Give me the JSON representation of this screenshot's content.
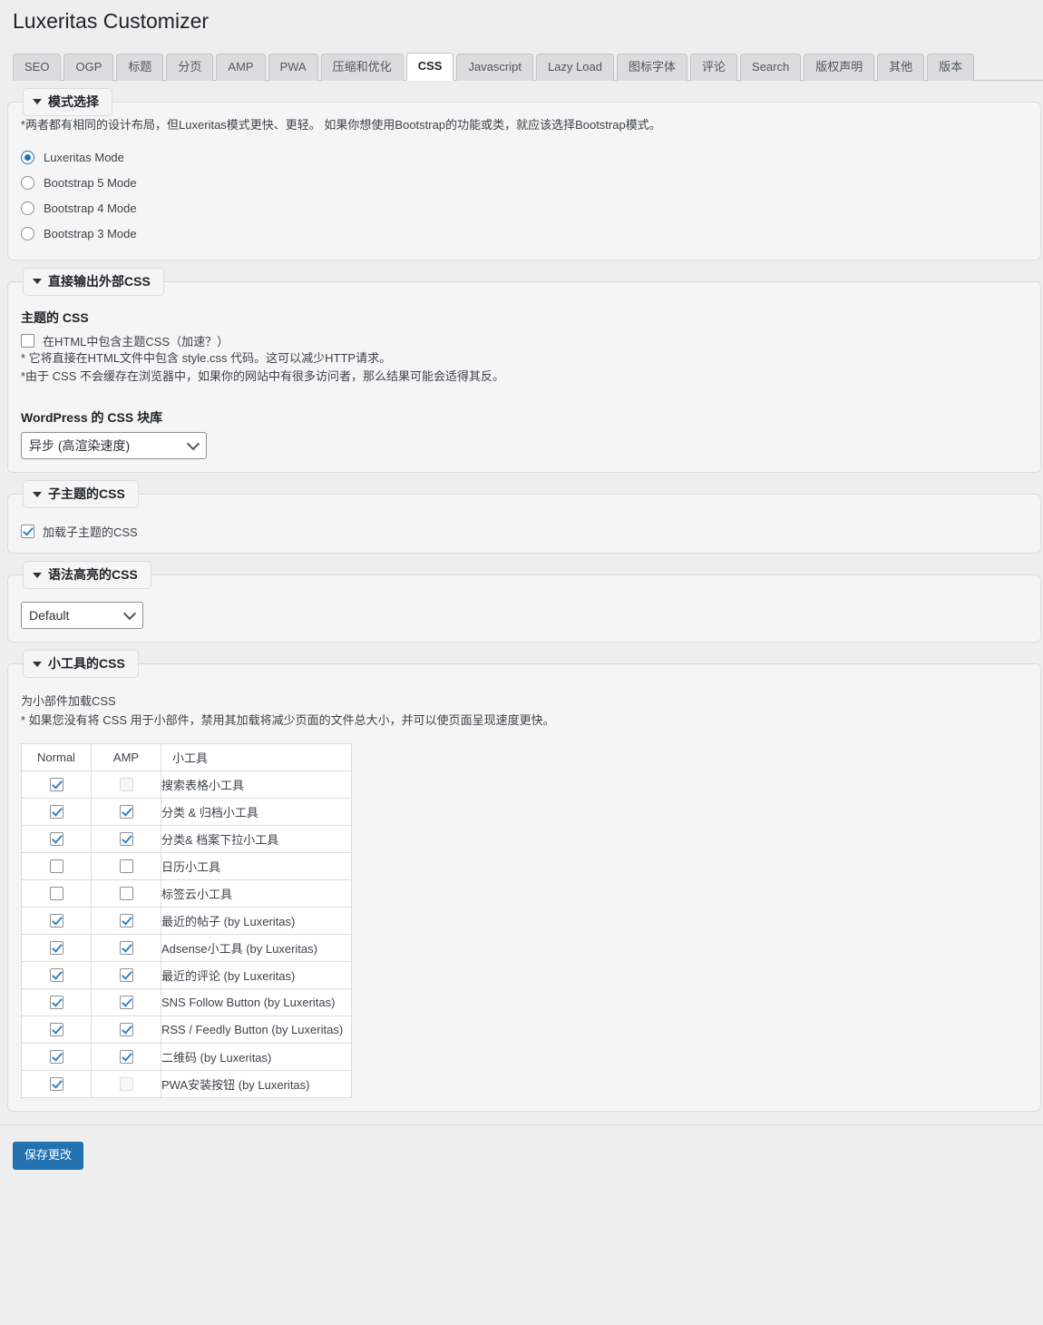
{
  "page": {
    "title": "Luxeritas Customizer",
    "accent_color": "#2271b1",
    "check_color": "#3582c4"
  },
  "tabs": [
    {
      "label": "SEO",
      "active": false
    },
    {
      "label": "OGP",
      "active": false
    },
    {
      "label": "标题",
      "active": false
    },
    {
      "label": "分页",
      "active": false
    },
    {
      "label": "AMP",
      "active": false
    },
    {
      "label": "PWA",
      "active": false
    },
    {
      "label": "压缩和优化",
      "active": false
    },
    {
      "label": "CSS",
      "active": true
    },
    {
      "label": "Javascript",
      "active": false
    },
    {
      "label": "Lazy Load",
      "active": false
    },
    {
      "label": "图标字体",
      "active": false
    },
    {
      "label": "评论",
      "active": false
    },
    {
      "label": "Search",
      "active": false
    },
    {
      "label": "版权声明",
      "active": false
    },
    {
      "label": "其他",
      "active": false
    },
    {
      "label": "版本",
      "active": false
    }
  ],
  "mode_section": {
    "legend": "模式选择",
    "note": "*两者都有相同的设计布局，但Luxeritas模式更快、更轻。 如果你想使用Bootstrap的功能或类，就应该选择Bootstrap模式。",
    "options": [
      {
        "label": "Luxeritas Mode",
        "checked": true
      },
      {
        "label": "Bootstrap 5 Mode",
        "checked": false
      },
      {
        "label": "Bootstrap 4 Mode",
        "checked": false
      },
      {
        "label": "Bootstrap 3 Mode",
        "checked": false
      }
    ]
  },
  "external_css_section": {
    "legend": "直接输出外部CSS",
    "theme_css_heading": "主题的 CSS",
    "include_checkbox": {
      "label": "在HTML中包含主题CSS（加速？）",
      "checked": false
    },
    "note1": "* 它将直接在HTML文件中包含 style.css 代码。这可以减少HTTP请求。",
    "note2": "*由于 CSS 不会缓存在浏览器中，如果你的网站中有很多访问者，那么结果可能会适得其反。",
    "block_library_heading": "WordPress 的 CSS 块库",
    "block_library_select": {
      "value": "异步 (高渲染速度)",
      "options": [
        "异步 (高渲染速度)"
      ]
    }
  },
  "child_theme_section": {
    "legend": "子主题的CSS",
    "checkbox": {
      "label": "加载子主题的CSS",
      "checked": true
    }
  },
  "highlight_section": {
    "legend": "语法高亮的CSS",
    "select": {
      "value": "Default",
      "options": [
        "Default"
      ]
    }
  },
  "widget_css_section": {
    "legend": "小工具的CSS",
    "lead": "为小部件加载CSS",
    "note": "* 如果您没有将 CSS 用于小部件，禁用其加载将减少页面的文件总大小，并可以使页面呈现速度更快。",
    "table": {
      "headers": [
        "Normal",
        "AMP",
        "小工具"
      ],
      "rows": [
        {
          "name": "搜索表格小工具",
          "normal": true,
          "amp": false,
          "amp_disabled": true
        },
        {
          "name": "分类 & 归档小工具",
          "normal": true,
          "amp": true,
          "amp_disabled": false
        },
        {
          "name": "分类& 档案下拉小工具",
          "normal": true,
          "amp": true,
          "amp_disabled": false
        },
        {
          "name": "日历小工具",
          "normal": false,
          "amp": false,
          "amp_disabled": false
        },
        {
          "name": "标签云小工具",
          "normal": false,
          "amp": false,
          "amp_disabled": false
        },
        {
          "name": "最近的帖子 (by Luxeritas)",
          "normal": true,
          "amp": true,
          "amp_disabled": false
        },
        {
          "name": "Adsense小工具 (by Luxeritas)",
          "normal": true,
          "amp": true,
          "amp_disabled": false
        },
        {
          "name": "最近的评论 (by Luxeritas)",
          "normal": true,
          "amp": true,
          "amp_disabled": false
        },
        {
          "name": "SNS Follow Button (by Luxeritas)",
          "normal": true,
          "amp": true,
          "amp_disabled": false
        },
        {
          "name": "RSS / Feedly Button (by Luxeritas)",
          "normal": true,
          "amp": true,
          "amp_disabled": false
        },
        {
          "name": "二维码 (by Luxeritas)",
          "normal": true,
          "amp": true,
          "amp_disabled": false
        },
        {
          "name": "PWA安装按钮 (by Luxeritas)",
          "normal": true,
          "amp": false,
          "amp_disabled": true
        }
      ]
    }
  },
  "footer": {
    "save_label": "保存更改"
  }
}
